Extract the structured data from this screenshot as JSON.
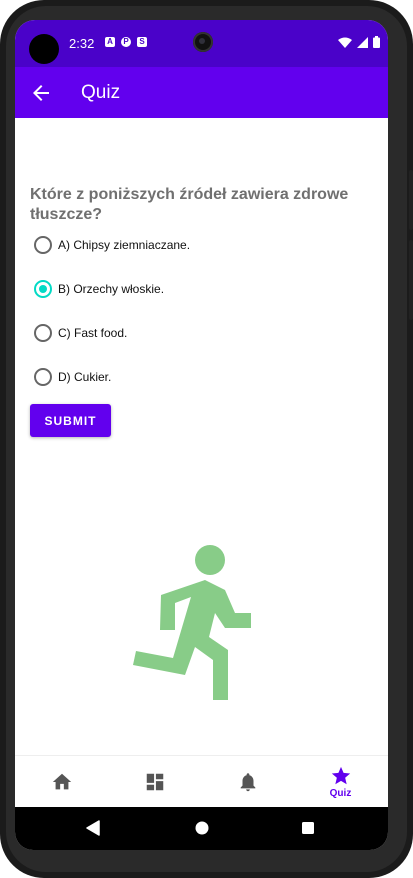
{
  "status_bar": {
    "time": "2:32",
    "notification_icons": [
      "A",
      "P",
      "S"
    ],
    "background_color": "#4a02c9"
  },
  "app_bar": {
    "title": "Quiz",
    "back_icon": "arrow-left-icon",
    "background_color": "#6200ee"
  },
  "quiz": {
    "question": "Które z poniższych źródeł zawiera zdrowe tłuszcze?",
    "options": [
      {
        "label": "A) Chipsy ziemniaczane.",
        "checked": false
      },
      {
        "label": "B) Orzechy włoskie.",
        "checked": true
      },
      {
        "label": "C) Fast food.",
        "checked": false
      },
      {
        "label": "D) Cukier.",
        "checked": false
      }
    ],
    "submit_label": "SUBMIT"
  },
  "illustration": {
    "icon": "running-person-icon",
    "color": "#88cc88"
  },
  "bottom_nav": {
    "items": [
      {
        "icon": "home-icon",
        "label": "",
        "active": false
      },
      {
        "icon": "dashboard-icon",
        "label": "",
        "active": false
      },
      {
        "icon": "bell-icon",
        "label": "",
        "active": false
      },
      {
        "icon": "star-icon",
        "label": "Quiz",
        "active": true
      }
    ],
    "active_color": "#6200ee",
    "inactive_color": "#555555"
  },
  "system_nav": {
    "buttons": [
      "back-triangle-icon",
      "home-circle-icon",
      "recents-square-icon"
    ]
  }
}
